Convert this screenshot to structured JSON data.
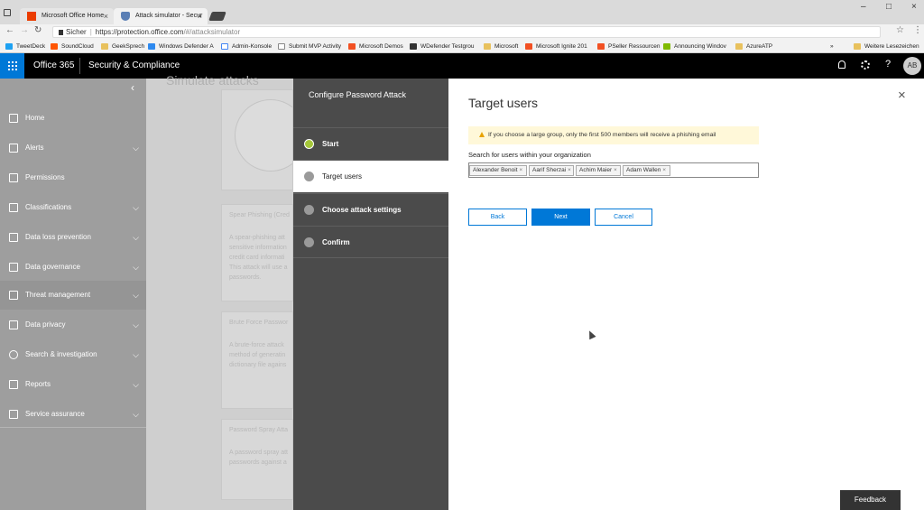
{
  "browser": {
    "tabs": [
      {
        "title": "Microsoft Office Home",
        "close": "×"
      },
      {
        "title": "Attack simulator - Secur",
        "close": "×"
      }
    ],
    "window_controls": {
      "minimize": "–",
      "maximize": "□",
      "close": "×"
    },
    "secure_label": "Sicher",
    "url_prefix": "https://protection.office.com",
    "url_path": "/#/attacksimulator",
    "bookmarks": [
      "TweetDeck",
      "SoundCloud",
      "GeekSprech",
      "Windows Defender A",
      "Admin-Konsole",
      "Submit MVP Activity",
      "Microsoft Demos",
      "WDefender Testgrou",
      "Microsoft",
      "Microsoft Ignite 201",
      "PSeller Ressourcen",
      "Announcing Windov",
      "AzureATP"
    ],
    "bookmarks_overflow": "»",
    "other_bookmarks": "Weitere Lesezeichen"
  },
  "header": {
    "app_name": "Office 365",
    "product": "Security & Compliance",
    "avatar_initials": "AB"
  },
  "nav": {
    "collapse": "‹",
    "items": [
      {
        "label": "Home",
        "chevron": ""
      },
      {
        "label": "Alerts",
        "chevron": "⌵"
      },
      {
        "label": "Permissions",
        "chevron": ""
      },
      {
        "label": "Classifications",
        "chevron": "⌵"
      },
      {
        "label": "Data loss prevention",
        "chevron": "⌵"
      },
      {
        "label": "Data governance",
        "chevron": "⌵"
      },
      {
        "label": "Threat management",
        "chevron": "⌵"
      },
      {
        "label": "Data privacy",
        "chevron": "⌵"
      },
      {
        "label": "Search & investigation",
        "chevron": "⌵"
      },
      {
        "label": "Reports",
        "chevron": "⌵"
      },
      {
        "label": "Service assurance",
        "chevron": "⌵"
      }
    ]
  },
  "background_page": {
    "title": "Simulate attacks",
    "cards": [
      {
        "title": "Spear Phishing (Cred",
        "lines": [
          "A spear-phishing att",
          "sensitive information",
          "credit card informati",
          "This attack will use a",
          "passwords."
        ]
      },
      {
        "title": "Brute Force Passwor",
        "lines": [
          "A brute-force attack",
          "method of generatin",
          "dictionary file agains"
        ]
      },
      {
        "title": "Password Spray Atta",
        "lines": [
          "A password spray att",
          "passwords against a"
        ]
      }
    ]
  },
  "wizard": {
    "title": "Configure Password Attack",
    "steps": [
      {
        "label": "Start",
        "state": "done"
      },
      {
        "label": "Target users",
        "state": "active"
      },
      {
        "label": "Choose attack settings",
        "state": "pending"
      },
      {
        "label": "Confirm",
        "state": "pending"
      }
    ],
    "panel_title": "Target users",
    "close": "×",
    "warning": "If you choose a large group, only the first 500 members will receive a phishing email",
    "search_label": "Search for users within your organization",
    "selected_users": [
      "Alexander Benoit",
      "Aarif Sherzai",
      "Achim Maier",
      "Adam Wallen"
    ],
    "remove_glyph": "×",
    "back_label": "Back",
    "next_label": "Next",
    "cancel_label": "Cancel"
  },
  "feedback_label": "Feedback",
  "colors": {
    "accent": "#0078d7",
    "done": "#a4c639",
    "warning_bg": "#fff8d9"
  }
}
